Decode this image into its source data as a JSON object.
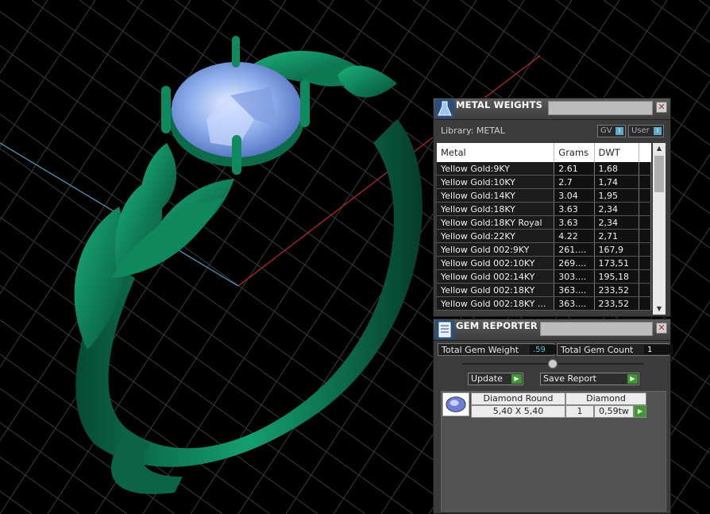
{
  "metal_weights": {
    "title": "METAL WEIGHTS",
    "library_label": "Library: METAL",
    "toggle_gv": "GV",
    "toggle_user": "User",
    "columns": [
      "Metal",
      "Grams",
      "DWT"
    ],
    "rows": [
      [
        "Yellow Gold:9KY",
        "2.61",
        "1,68"
      ],
      [
        "Yellow Gold:10KY",
        "2.7",
        "1,74"
      ],
      [
        "Yellow Gold:14KY",
        "3.04",
        "1,95"
      ],
      [
        "Yellow Gold:18KY",
        "3.63",
        "2,34"
      ],
      [
        "Yellow Gold:18KY Royal",
        "3.63",
        "2,34"
      ],
      [
        "Yellow Gold:22KY",
        "4.22",
        "2,71"
      ],
      [
        "Yellow Gold 002:9KY",
        "261....",
        "167,9"
      ],
      [
        "Yellow Gold 002:10KY",
        "269....",
        "173,51"
      ],
      [
        "Yellow Gold 002:14KY",
        "303....",
        "195,18"
      ],
      [
        "Yellow Gold 002:18KY",
        "363....",
        "233,52"
      ],
      [
        "Yellow Gold 002:18KY ...",
        "363....",
        "233,52"
      ]
    ]
  },
  "gem_reporter": {
    "title": "GEM REPORTER",
    "total_weight_label": "Total Gem Weight",
    "total_weight_value": ".59",
    "total_count_label": "Total Gem Count",
    "total_count_value": "1",
    "update_label": "Update",
    "save_report_label": "Save Report",
    "gem": {
      "name": "Diamond Round",
      "material": "Diamond",
      "size": "5,40 X 5,40",
      "quantity": "1",
      "weight": "0,59tw"
    }
  },
  "colors": {
    "ring_green": "#0f7a55",
    "gem_blue": "#8fb0ee",
    "panel_bg": "#3b3b3b",
    "accent_cyan": "#5dbcd8",
    "play_green": "#3d9a2f"
  }
}
